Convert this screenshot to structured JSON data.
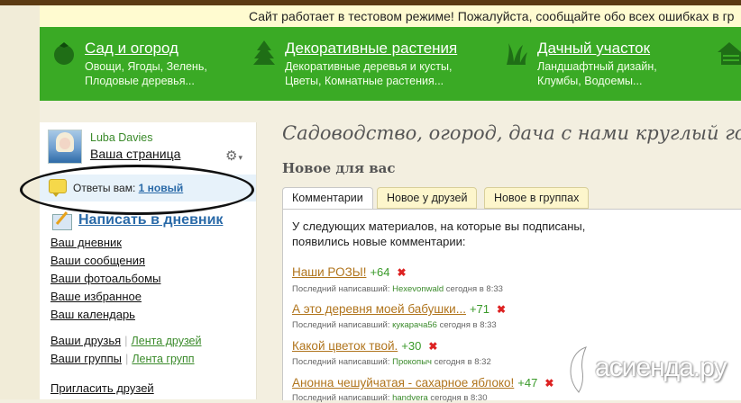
{
  "notice": "Сайт работает в тестовом режиме! Пожалуйста, сообщайте обо всех ошибках в гр",
  "nav": [
    {
      "title": "Сад и огород",
      "sub1": "Овощи, Ягоды, Зелень,",
      "sub2": "Плодовые деревья...",
      "icon": "tomato-icon"
    },
    {
      "title": "Декоративные растения",
      "sub1": "Декоративные деревья и кусты,",
      "sub2": "Цветы, Комнатные растения...",
      "icon": "fir-tree-icon"
    },
    {
      "title": "Дачный участок",
      "sub1": "Ландшафтный дизайн,",
      "sub2": "Клумбы, Водоемы...",
      "icon": "grass-icon"
    }
  ],
  "user": {
    "name": "Luba Davies",
    "page_link": "Ваша страница"
  },
  "answers": {
    "label": "Ответы вам:",
    "link": "1 новый"
  },
  "write_diary": "Написать в дневник",
  "menu": {
    "diary": "Ваш дневник",
    "messages": "Ваши сообщения",
    "albums": "Ваши фотоальбомы",
    "favorites": "Ваше избранное",
    "calendar": "Ваш календарь",
    "friends": "Ваши друзья",
    "friends_feed": "Лента друзей",
    "groups": "Ваши группы",
    "groups_feed": "Лента групп",
    "invite": "Пригласить друзей"
  },
  "slogan": "Садоводство, огород, дача с нами круглый год!",
  "new_for_you": "Новое для вас",
  "tabs": [
    "Комментарии",
    "Новое у друзей",
    "Новое в группах"
  ],
  "intro": [
    "У следующих материалов, на которые вы подписаны,",
    "появились новые комментарии:"
  ],
  "last_writer_label": "Последний написавший:",
  "items": [
    {
      "title": "Наши РОЗЫ!",
      "count": "+64",
      "author": "Hexevonwald",
      "time": "сегодня в 8:33"
    },
    {
      "title": "А это деревня моей бабушки...",
      "count": "+71",
      "author": "кукарача56",
      "time": "сегодня в 8:33"
    },
    {
      "title": "Какой цветок твой.",
      "count": "+30",
      "author": "Прокопыч",
      "time": "сегодня в 8:32"
    },
    {
      "title": "Анонна чешуйчатая - сахарное яблоко!",
      "count": "+47",
      "author": "handvera",
      "time": "сегодня в 8:30"
    }
  ],
  "watermark": "асиенда.ру",
  "colors": {
    "nav_green": "#3aaa25",
    "link_blue": "#2a6aa8",
    "item_orange": "#b0741c",
    "count_green": "#3a9a2a"
  }
}
